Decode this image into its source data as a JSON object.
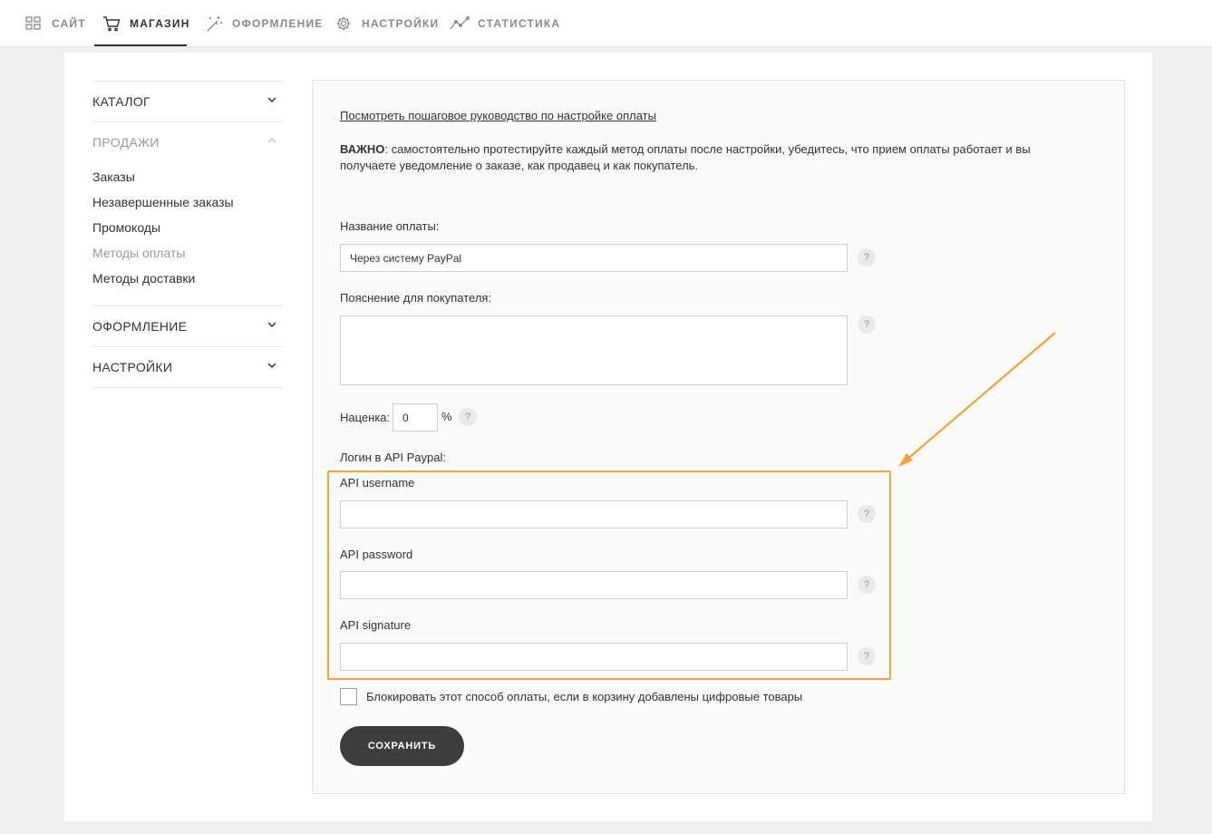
{
  "topnav": {
    "items": [
      {
        "label": "САЙТ",
        "icon": "grid-icon"
      },
      {
        "label": "МАГАЗИН",
        "icon": "cart-icon",
        "active": true
      },
      {
        "label": "ОФОРМЛЕНИЕ",
        "icon": "magic-wand-icon"
      },
      {
        "label": "НАСТРОЙКИ",
        "icon": "gear-icon"
      },
      {
        "label": "СТАТИСТИКА",
        "icon": "chart-line-icon"
      }
    ]
  },
  "sidebar": {
    "catalog": "КАТАЛОГ",
    "sales": "ПРОДАЖИ",
    "sales_items": [
      "Заказы",
      "Незавершенные заказы",
      "Промокоды",
      "Методы оплаты",
      "Методы доставки"
    ],
    "design": "ОФОРМЛЕНИЕ",
    "settings": "НАСТРОЙКИ"
  },
  "panel": {
    "guide_link": "Посмотреть пошаговое руководство по настройке оплаты",
    "important_prefix": "ВАЖНО",
    "important_text": ": самостоятельно протестируйте каждый метод оплаты после настройки, убедитесь, что прием оплаты работает и вы получаете уведомление о заказе, как продавец и как покупатель.",
    "payment_name_label": "Название оплаты:",
    "payment_name_value": "Через систему PayPal",
    "buyer_note_label": "Пояснение для покупателя:",
    "buyer_note_value": "",
    "markup_label": "Наценка:",
    "markup_value": "0",
    "markup_unit": "%",
    "api_login_label": "Логин в API Paypal:",
    "api_username_label": "API username",
    "api_username_value": "",
    "api_password_label": "API password",
    "api_password_value": "",
    "api_signature_label": "API signature",
    "api_signature_value": "",
    "help_symbol": "?",
    "block_digital_label": "Блокировать этот способ оплаты, если в корзину добавлены цифровые товары",
    "save_label": "СОХРАНИТЬ"
  },
  "colors": {
    "highlight": "#f0a43a",
    "button": "#3d3d3d"
  }
}
